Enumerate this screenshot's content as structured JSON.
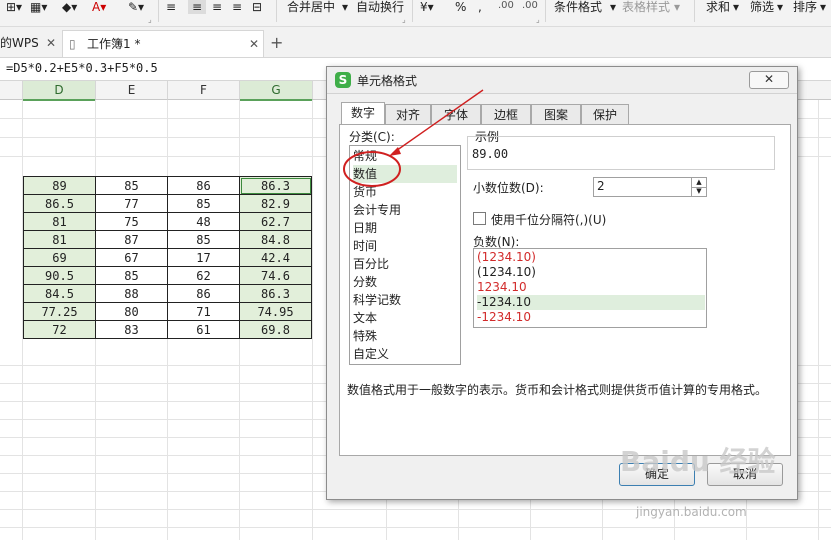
{
  "ribbon": {
    "merge_center": "合并居中",
    "auto_wrap": "自动换行",
    "percent": "%",
    "conditional_format": "条件格式",
    "table_style": "表格样式",
    "sum": "求和",
    "filter": "筛选",
    "sort": "排序",
    "dec_add": ".00",
    "dec_sub": ".00"
  },
  "tabs": {
    "home": "的WPS",
    "doc": "工作簿1 *",
    "add": "+"
  },
  "formula": "=D5*0.2+E5*0.3+F5*0.5",
  "sheet": {
    "columns": [
      "D",
      "E",
      "F",
      "G"
    ],
    "rows": [
      [
        "89",
        "85",
        "86",
        "86.3"
      ],
      [
        "86.5",
        "77",
        "85",
        "82.9"
      ],
      [
        "81",
        "75",
        "48",
        "62.7"
      ],
      [
        "81",
        "87",
        "85",
        "84.8"
      ],
      [
        "69",
        "67",
        "17",
        "42.4"
      ],
      [
        "90.5",
        "85",
        "62",
        "74.6"
      ],
      [
        "84.5",
        "88",
        "86",
        "86.3"
      ],
      [
        "77.25",
        "80",
        "71",
        "74.95"
      ],
      [
        "72",
        "83",
        "61",
        "69.8"
      ]
    ]
  },
  "dialog": {
    "title": "单元格格式",
    "logo": "S",
    "close": "✕",
    "tabs": [
      "数字",
      "对齐",
      "字体",
      "边框",
      "图案",
      "保护"
    ],
    "category_label": "分类(C):",
    "categories": [
      "常规",
      "数值",
      "货币",
      "会计专用",
      "日期",
      "时间",
      "百分比",
      "分数",
      "科学记数",
      "文本",
      "特殊",
      "自定义"
    ],
    "example_label": "示例",
    "example_value": "89.00",
    "decimal_label": "小数位数(D):",
    "decimal_value": "2",
    "thousands_label": "使用千位分隔符(,)(U)",
    "negative_label": "负数(N):",
    "negatives": [
      "(1234.10)",
      "(1234.10)",
      "1234.10",
      "-1234.10",
      "-1234.10"
    ],
    "description": "数值格式用于一般数字的表示。货币和会计格式则提供货币值计算的专用格式。",
    "ok": "确定",
    "cancel": "取消"
  },
  "watermark": {
    "brand": "Baidu 经验",
    "url": "jingyan.baidu.com"
  }
}
